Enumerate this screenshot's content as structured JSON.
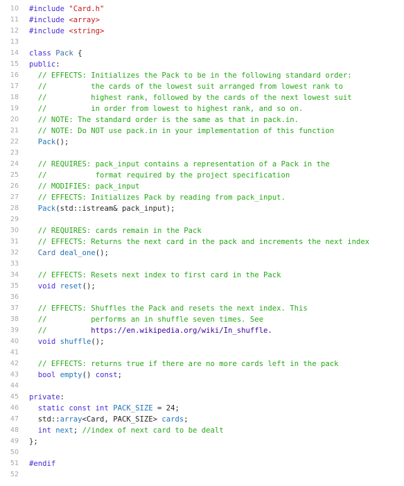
{
  "file": {
    "language": "C++",
    "lines": [
      {
        "n": "10",
        "tokens": [
          {
            "t": "#include ",
            "c": "kp"
          },
          {
            "t": "\"Card.h\"",
            "c": "str"
          }
        ]
      },
      {
        "n": "11",
        "tokens": [
          {
            "t": "#include ",
            "c": "kp"
          },
          {
            "t": "<array>",
            "c": "str"
          }
        ]
      },
      {
        "n": "12",
        "tokens": [
          {
            "t": "#include ",
            "c": "kp"
          },
          {
            "t": "<string>",
            "c": "str"
          }
        ]
      },
      {
        "n": "13",
        "tokens": []
      },
      {
        "n": "14",
        "tokens": [
          {
            "t": "class ",
            "c": "kp"
          },
          {
            "t": "Pack",
            "c": "ty2"
          },
          {
            "t": " {",
            "c": "pl"
          }
        ]
      },
      {
        "n": "15",
        "tokens": [
          {
            "t": "public",
            "c": "kp"
          },
          {
            "t": ":",
            "c": "pl"
          }
        ]
      },
      {
        "n": "16",
        "tokens": [
          {
            "t": "  // EFFECTS: Initializes the Pack to be in the following standard order:",
            "c": "cm"
          }
        ]
      },
      {
        "n": "17",
        "tokens": [
          {
            "t": "  //          the cards of the lowest suit arranged from lowest rank to",
            "c": "cm"
          }
        ]
      },
      {
        "n": "18",
        "tokens": [
          {
            "t": "  //          highest rank, followed by the cards of the next lowest suit",
            "c": "cm"
          }
        ]
      },
      {
        "n": "19",
        "tokens": [
          {
            "t": "  //          in order from lowest to highest rank, and so on.",
            "c": "cm"
          }
        ]
      },
      {
        "n": "20",
        "tokens": [
          {
            "t": "  // NOTE: The standard order is the same as that in pack.in.",
            "c": "cm"
          }
        ]
      },
      {
        "n": "21",
        "tokens": [
          {
            "t": "  // NOTE: Do NOT use pack.in in your implementation of this function",
            "c": "cm"
          }
        ]
      },
      {
        "n": "22",
        "tokens": [
          {
            "t": "  ",
            "c": "pl"
          },
          {
            "t": "Pack",
            "c": "fnc"
          },
          {
            "t": "();",
            "c": "pl"
          }
        ]
      },
      {
        "n": "23",
        "tokens": []
      },
      {
        "n": "24",
        "tokens": [
          {
            "t": "  // REQUIRES: pack_input contains a representation of a Pack in the",
            "c": "cm"
          }
        ]
      },
      {
        "n": "25",
        "tokens": [
          {
            "t": "  //           format required by the project specification",
            "c": "cm"
          }
        ]
      },
      {
        "n": "26",
        "tokens": [
          {
            "t": "  // MODIFIES: pack_input",
            "c": "cm"
          }
        ]
      },
      {
        "n": "27",
        "tokens": [
          {
            "t": "  // EFFECTS: Initializes Pack by reading from pack_input.",
            "c": "cm"
          }
        ]
      },
      {
        "n": "28",
        "tokens": [
          {
            "t": "  ",
            "c": "pl"
          },
          {
            "t": "Pack",
            "c": "fnc"
          },
          {
            "t": "(std::istream& pack_input);",
            "c": "pl"
          }
        ]
      },
      {
        "n": "29",
        "tokens": []
      },
      {
        "n": "30",
        "tokens": [
          {
            "t": "  // REQUIRES: cards remain in the Pack",
            "c": "cm"
          }
        ]
      },
      {
        "n": "31",
        "tokens": [
          {
            "t": "  // EFFECTS: Returns the next card in the pack and increments the next index",
            "c": "cm"
          }
        ]
      },
      {
        "n": "32",
        "tokens": [
          {
            "t": "  ",
            "c": "pl"
          },
          {
            "t": "Card",
            "c": "ty2"
          },
          {
            "t": " ",
            "c": "pl"
          },
          {
            "t": "deal_one",
            "c": "fnc"
          },
          {
            "t": "();",
            "c": "pl"
          }
        ]
      },
      {
        "n": "33",
        "tokens": []
      },
      {
        "n": "34",
        "tokens": [
          {
            "t": "  // EFFECTS: Resets next index to first card in the Pack",
            "c": "cm"
          }
        ]
      },
      {
        "n": "35",
        "tokens": [
          {
            "t": "  ",
            "c": "pl"
          },
          {
            "t": "void",
            "c": "kp"
          },
          {
            "t": " ",
            "c": "pl"
          },
          {
            "t": "reset",
            "c": "fnc"
          },
          {
            "t": "();",
            "c": "pl"
          }
        ]
      },
      {
        "n": "36",
        "tokens": []
      },
      {
        "n": "37",
        "tokens": [
          {
            "t": "  // EFFECTS: Shuffles the Pack and resets the next index. This",
            "c": "cm"
          }
        ]
      },
      {
        "n": "38",
        "tokens": [
          {
            "t": "  //          performs an in shuffle seven times. See",
            "c": "cm"
          }
        ]
      },
      {
        "n": "39",
        "tokens": [
          {
            "t": "  //          ",
            "c": "cm"
          },
          {
            "t": "https://en.wikipedia.org/wiki/In_shuffle.",
            "c": "link"
          }
        ]
      },
      {
        "n": "40",
        "tokens": [
          {
            "t": "  ",
            "c": "pl"
          },
          {
            "t": "void",
            "c": "kp"
          },
          {
            "t": " ",
            "c": "pl"
          },
          {
            "t": "shuffle",
            "c": "fnc"
          },
          {
            "t": "();",
            "c": "pl"
          }
        ]
      },
      {
        "n": "41",
        "tokens": []
      },
      {
        "n": "42",
        "tokens": [
          {
            "t": "  // EFFECTS: returns true if there are no more cards left in the pack",
            "c": "cm"
          }
        ]
      },
      {
        "n": "43",
        "tokens": [
          {
            "t": "  ",
            "c": "pl"
          },
          {
            "t": "bool",
            "c": "kp"
          },
          {
            "t": " ",
            "c": "pl"
          },
          {
            "t": "empty",
            "c": "fnc"
          },
          {
            "t": "() ",
            "c": "pl"
          },
          {
            "t": "const",
            "c": "kp"
          },
          {
            "t": ";",
            "c": "pl"
          }
        ]
      },
      {
        "n": "44",
        "tokens": []
      },
      {
        "n": "45",
        "tokens": [
          {
            "t": "private",
            "c": "kp"
          },
          {
            "t": ":",
            "c": "pl"
          }
        ]
      },
      {
        "n": "46",
        "tokens": [
          {
            "t": "  ",
            "c": "pl"
          },
          {
            "t": "static const int",
            "c": "kp"
          },
          {
            "t": " ",
            "c": "pl"
          },
          {
            "t": "PACK_SIZE",
            "c": "fnc"
          },
          {
            "t": " = 24;",
            "c": "pl"
          }
        ]
      },
      {
        "n": "47",
        "tokens": [
          {
            "t": "  std::",
            "c": "pl"
          },
          {
            "t": "array",
            "c": "fnc"
          },
          {
            "t": "<Card, PACK_SIZE> ",
            "c": "pl"
          },
          {
            "t": "cards",
            "c": "fnc"
          },
          {
            "t": ";",
            "c": "pl"
          }
        ]
      },
      {
        "n": "48",
        "tokens": [
          {
            "t": "  ",
            "c": "pl"
          },
          {
            "t": "int",
            "c": "kp"
          },
          {
            "t": " ",
            "c": "pl"
          },
          {
            "t": "next",
            "c": "fnc"
          },
          {
            "t": "; ",
            "c": "pl"
          },
          {
            "t": "//index of next card to be dealt",
            "c": "cm"
          }
        ]
      },
      {
        "n": "49",
        "tokens": [
          {
            "t": "};",
            "c": "pl"
          }
        ]
      },
      {
        "n": "50",
        "tokens": []
      },
      {
        "n": "51",
        "tokens": [
          {
            "t": "#endif",
            "c": "kp"
          }
        ]
      },
      {
        "n": "52",
        "tokens": []
      }
    ]
  }
}
